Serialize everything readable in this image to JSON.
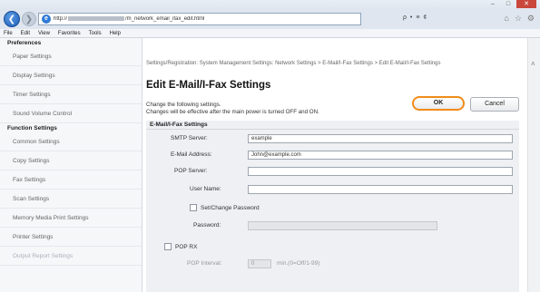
{
  "browser": {
    "url_prefix": "http://",
    "url_suffix": "/m_network_email_ifax_edit.html",
    "address_tools": "ρ • ≡ ¢",
    "menu": [
      "File",
      "Edit",
      "View",
      "Favorites",
      "Tools",
      "Help"
    ]
  },
  "sidebar": {
    "sections": [
      {
        "title": "Preferences",
        "items": [
          "Paper Settings",
          "Display Settings",
          "Timer Settings",
          "Sound Volume Control"
        ]
      },
      {
        "title": "Function Settings",
        "items": [
          "Common Settings",
          "Copy Settings",
          "Fax Settings",
          "Scan Settings",
          "Memory Media Print Settings",
          "Printer Settings",
          "Output Report Settings"
        ]
      }
    ]
  },
  "main": {
    "breadcrumb": "Settings/Registration: System Management Settings: Network Settings > E-Mail/I-Fax Settings > Edit E-Mail/I-Fax Settings",
    "title": "Edit E-Mail/I-Fax Settings",
    "notice_line1": "Change the following settings.",
    "notice_line2": "Changes will be effective after the main power is turned OFF and ON.",
    "ok_label": "OK",
    "cancel_label": "Cancel",
    "panel_title": "E-Mail/I-Fax Settings",
    "fields": {
      "smtp_label": "SMTP Server:",
      "smtp_value": "example",
      "email_label": "E-Mail Address:",
      "email_value": "John@example.com",
      "pop_label": "POP Server:",
      "pop_value": "",
      "user_label": "User Name:",
      "user_value": "",
      "setpw_label": "Set/Change Password",
      "password_label": "Password:",
      "password_value": "",
      "poprx_label": "POP RX",
      "popinterval_label": "POP Interval:",
      "popinterval_value": "0",
      "popinterval_unit": "min.(0=Off/1-99)"
    }
  }
}
